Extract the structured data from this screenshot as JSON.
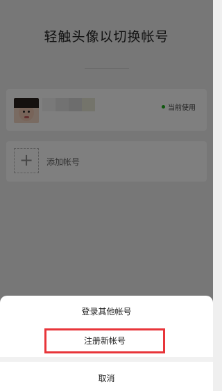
{
  "page": {
    "title": "轻触头像以切换帐号"
  },
  "current_account": {
    "status_label": "当前使用",
    "status_color": "#1aad19"
  },
  "add_account": {
    "icon": "plus-icon",
    "label": "添加帐号"
  },
  "action_sheet": {
    "login_other_label": "登录其他帐号",
    "register_label": "注册新帐号",
    "cancel_label": "取消",
    "highlight_color": "#e8353a"
  }
}
